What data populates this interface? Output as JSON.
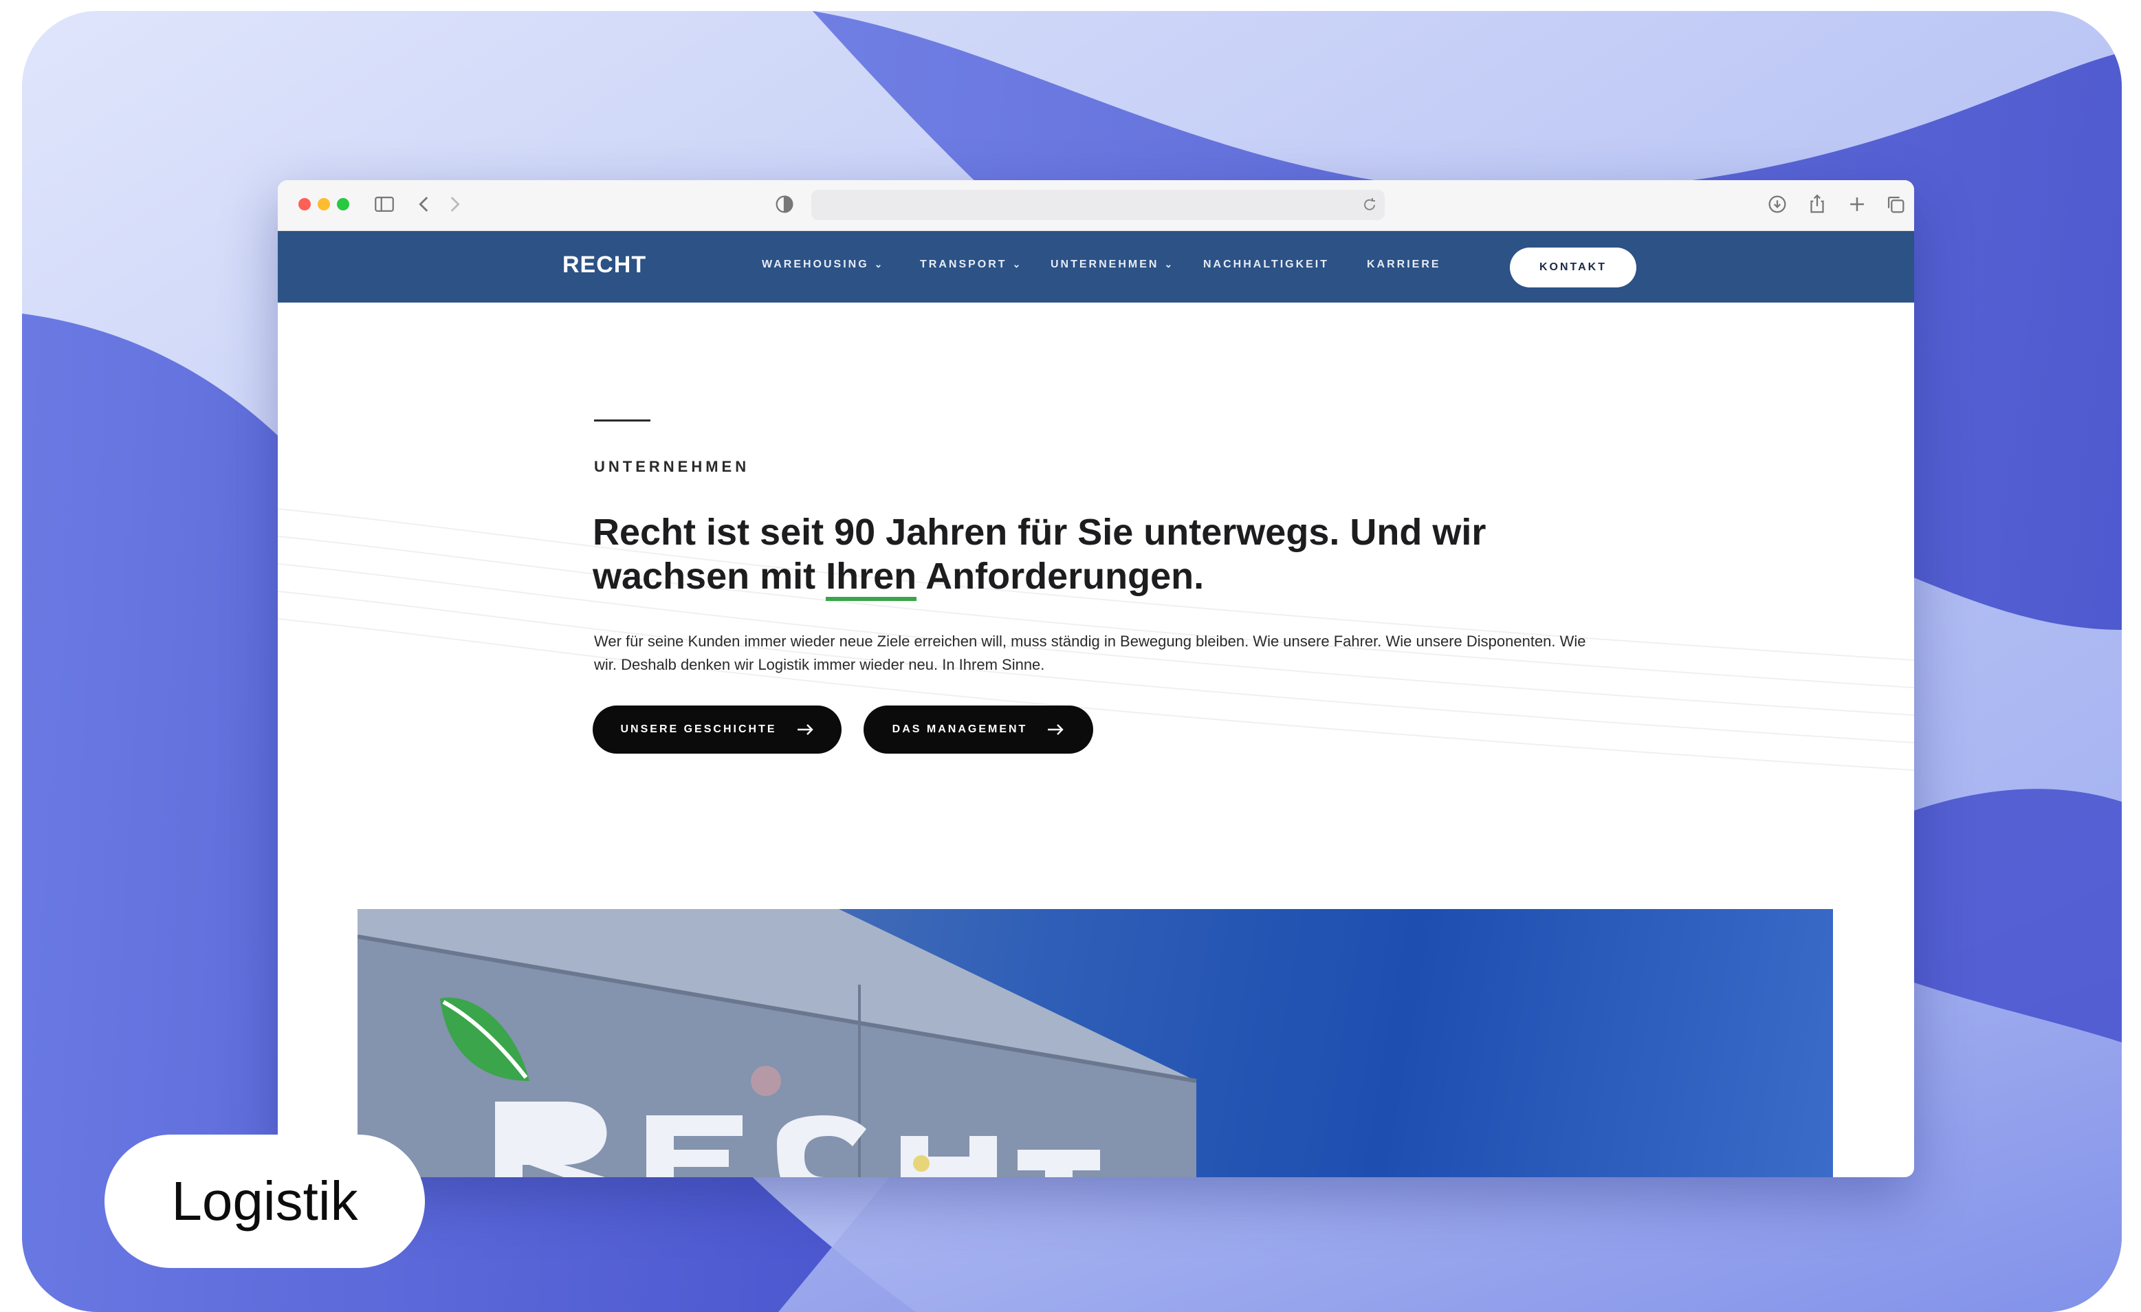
{
  "browser": {
    "window_controls": [
      "close",
      "minimize",
      "zoom"
    ],
    "toolbar_icons": [
      "sidebar-icon",
      "back-icon",
      "forward-icon",
      "shield-icon",
      "reload-icon",
      "download-icon",
      "share-icon",
      "new-tab-icon",
      "tabs-icon"
    ],
    "url": ""
  },
  "site": {
    "logo": "RECHT",
    "nav": [
      {
        "label": "WAREHOUSING",
        "has_dropdown": true
      },
      {
        "label": "TRANSPORT",
        "has_dropdown": true
      },
      {
        "label": "UNTERNEHMEN",
        "has_dropdown": true
      },
      {
        "label": "NACHHALTIGKEIT",
        "has_dropdown": false
      },
      {
        "label": "KARRIERE",
        "has_dropdown": false
      }
    ],
    "contact_button": "KONTAKT",
    "nav_color": "#2c5286"
  },
  "hero": {
    "eyebrow": "UNTERNEHMEN",
    "headline_part1": "Recht ist seit 90 Jahren für Sie unterwegs. Und wir wachsen mit ",
    "headline_highlight": "Ihren",
    "headline_part2": " Anforderungen.",
    "highlight_color": "#3aa54a",
    "paragraph": "Wer für seine Kunden immer wieder neue Ziele erreichen will, muss ständig in Bewegung bleiben. Wie unsere Fahrer. Wie unsere Disponenten. Wie wir. Deshalb denken wir Logistik immer wieder neu. In Ihrem Sinne.",
    "buttons": [
      {
        "label": "UNSERE GESCHICHTE"
      },
      {
        "label": "DAS MANAGEMENT"
      }
    ],
    "photo_sign_text": "RECHT"
  },
  "category_label": "Logistik"
}
